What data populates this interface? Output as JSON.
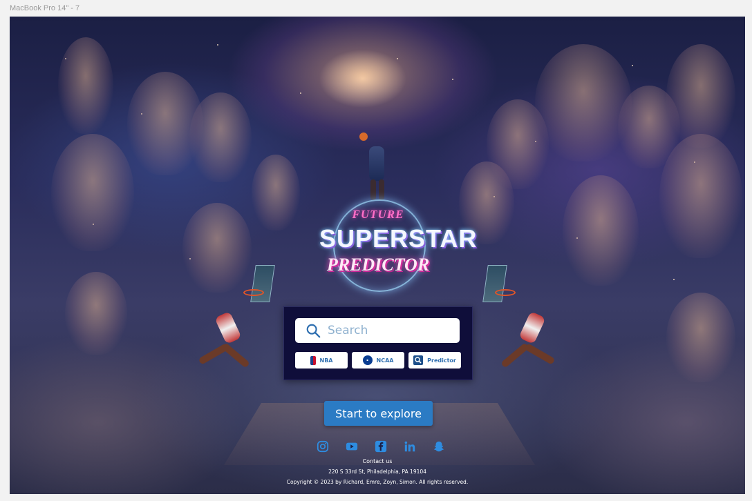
{
  "frame_label": "MacBook Pro 14\" - 7",
  "logo": {
    "line1": "FUTURE",
    "line2": "SUPERSTAR",
    "line3": "PREDICTOR"
  },
  "search": {
    "placeholder": "Search"
  },
  "filters": [
    {
      "label": "NBA",
      "icon": "nba-logo-icon"
    },
    {
      "label": "NCAA",
      "icon": "ncaa-logo-icon"
    },
    {
      "label": "Predictor",
      "icon": "predictor-icon"
    }
  ],
  "cta": {
    "label": "Start to explore"
  },
  "social": [
    {
      "name": "instagram-icon"
    },
    {
      "name": "youtube-icon"
    },
    {
      "name": "facebook-icon"
    },
    {
      "name": "linkedin-icon"
    },
    {
      "name": "snapchat-icon"
    }
  ],
  "footer": {
    "contact": "Contact us",
    "address": "220 S 33rd St, Philadelphia, PA 19104",
    "copyright": "Copyright © 2023 by Richard, Emre, Zoyn, Simon. All rights reserved."
  },
  "colors": {
    "panel": "#0f0e3a",
    "accent": "#2b7bc4",
    "chip_text": "#2f6fb0",
    "social": "#2e8ce0"
  }
}
